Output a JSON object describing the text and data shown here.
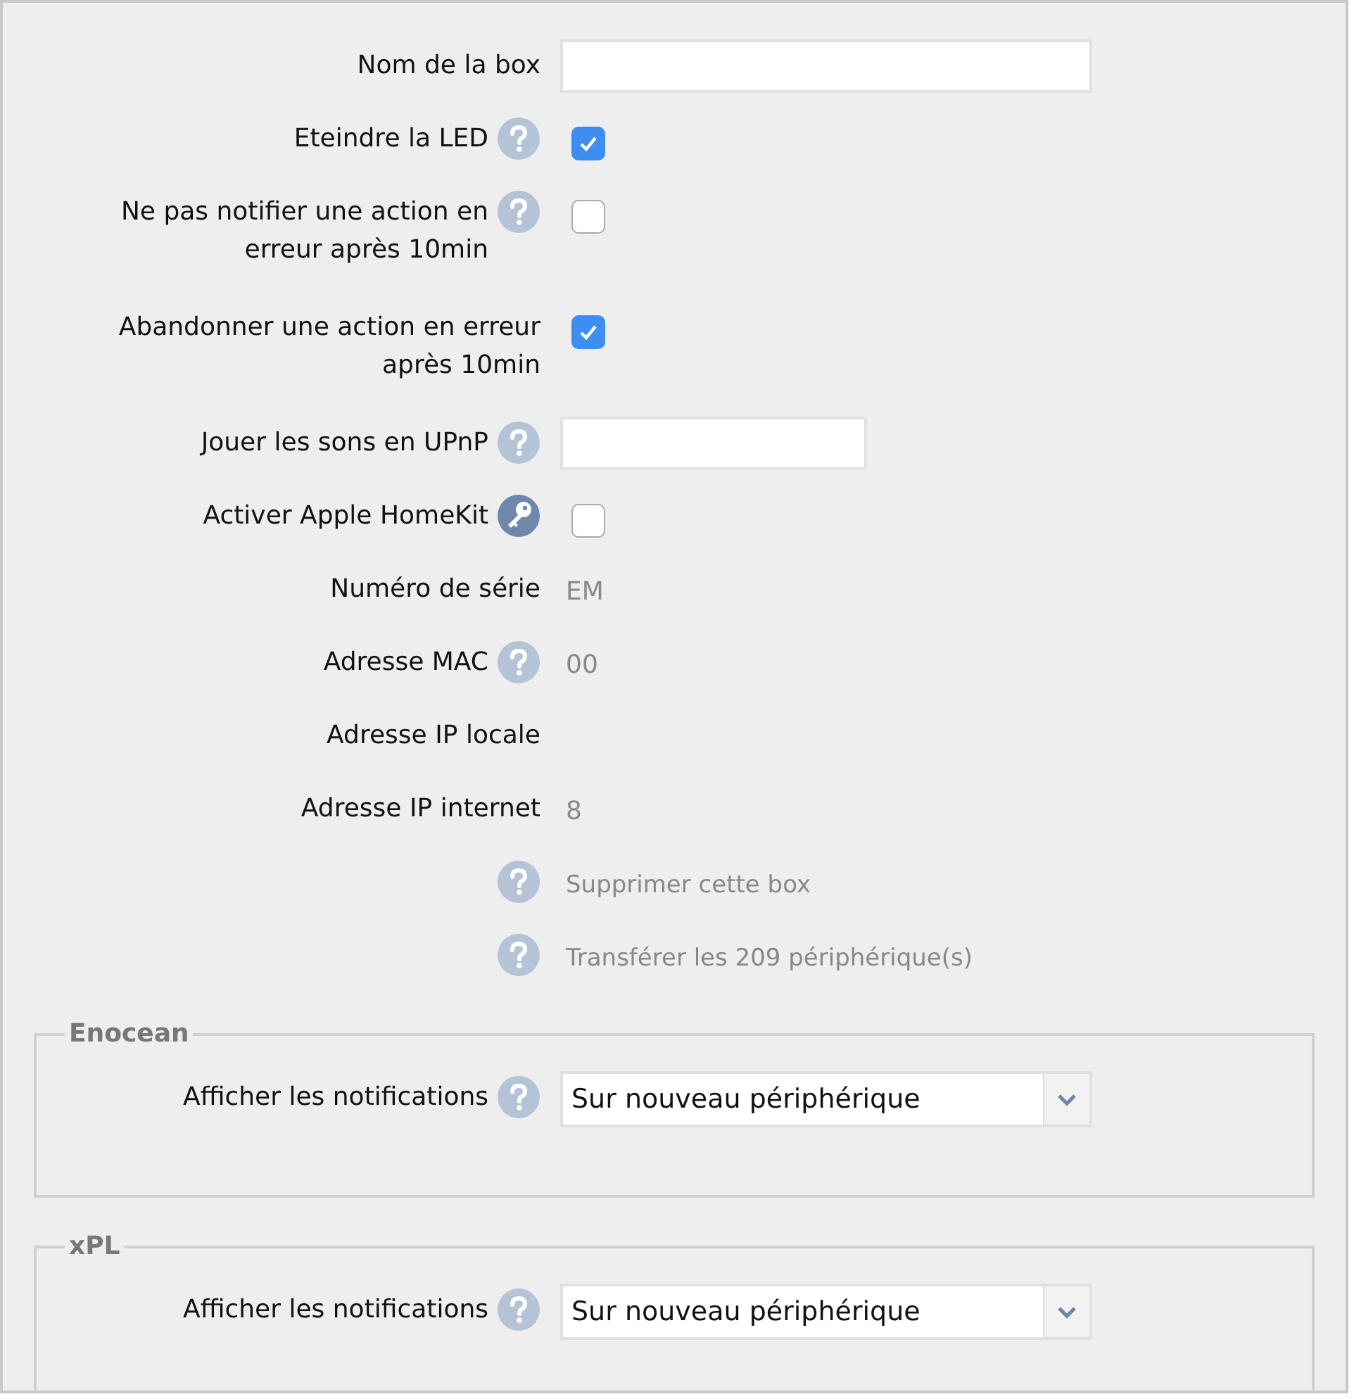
{
  "rows": [
    {
      "kind": "input",
      "label": "Nom de la box",
      "help": false
    },
    {
      "kind": "checkbox",
      "label": "Eteindre la LED",
      "help": true,
      "checked": true
    },
    {
      "kind": "checkbox",
      "label": "Ne pas notifier une action en erreur après 10min",
      "help": true,
      "checked": false
    },
    {
      "kind": "checkbox",
      "label": "Abandonner une action en erreur après 10min",
      "help": false,
      "checked": true
    },
    {
      "kind": "input",
      "label": "Jouer les sons en UPnP",
      "help": true
    },
    {
      "kind": "keycheckbox",
      "label": "Activer Apple HomeKit",
      "checked": false
    },
    {
      "kind": "info",
      "label": "Numéro de série",
      "help": false,
      "value": "EM"
    },
    {
      "kind": "info",
      "label": "Adresse MAC",
      "help": true,
      "value": "00"
    },
    {
      "kind": "info",
      "label": "Adresse IP locale",
      "help": false
    },
    {
      "kind": "info",
      "label": "Adresse IP internet",
      "help": false,
      "value": "8"
    },
    {
      "kind": "action",
      "help": true,
      "text": "Supprimer cette box"
    },
    {
      "kind": "action",
      "help": true,
      "text": "Transférer les 209 périphérique(s)"
    }
  ],
  "sections": [
    {
      "legend": "Enocean",
      "label": "Afficher les notifications",
      "help": true,
      "value": "Sur nouveau périphérique"
    },
    {
      "legend": "xPL",
      "label": "Afficher les notifications",
      "help": true,
      "value": "Sur nouveau périphérique"
    }
  ]
}
